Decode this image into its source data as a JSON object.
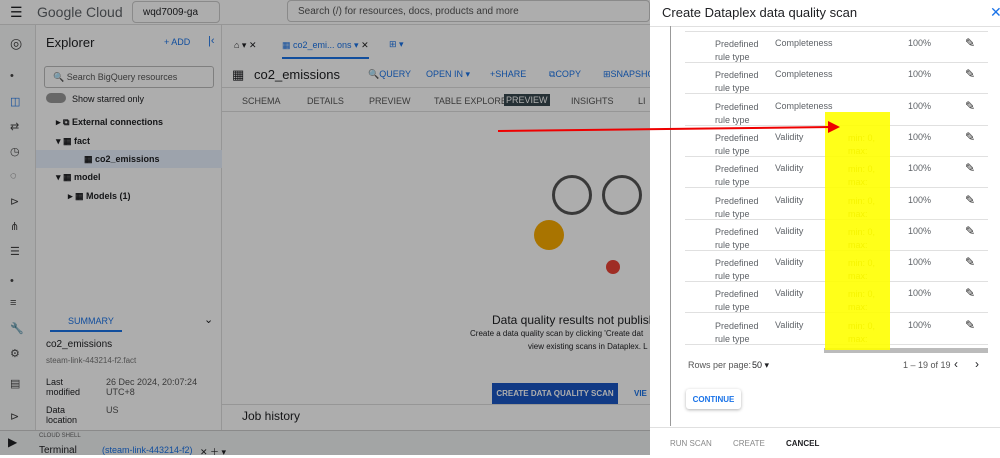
{
  "topbar": {
    "brand": "Google Cloud",
    "project": "wqd7009-ga",
    "search_placeholder": "Search (/) for resources, docs, products and more"
  },
  "explorer": {
    "title": "Explorer",
    "add": "+ ADD",
    "search_placeholder": "Search BigQuery resources",
    "starred": "Show starred only",
    "tree": [
      {
        "label": "External connections"
      },
      {
        "label": "fact"
      },
      {
        "label": "co2_emissions"
      },
      {
        "label": "model"
      },
      {
        "label": "Models (1)"
      }
    ],
    "summary_tab": "SUMMARY",
    "summary_name": "co2_emissions",
    "summary_path": "steam-link-443214-f2.fact",
    "details": [
      {
        "k": "Last modified",
        "v": "26 Dec 2024, 20:07:24 UTC+8"
      },
      {
        "k": "Data location",
        "v": "US"
      }
    ]
  },
  "main": {
    "tab": "co2_emi... ons",
    "table": "co2_emissions",
    "actions": [
      "QUERY",
      "OPEN IN ▾",
      "SHARE",
      "COPY",
      "SNAPSHOT"
    ],
    "subtabs": [
      "SCHEMA",
      "DETAILS",
      "PREVIEW",
      "TABLE EXPLORER",
      "INSIGHTS",
      "LI"
    ],
    "preview_badge": "PREVIEW",
    "empty_title": "Data quality results not publish",
    "empty_line1": "Create a data quality scan by clicking 'Create dat",
    "empty_line2": "view existing scans in Dataplex. L",
    "create_button": "CREATE DATA QUALITY SCAN",
    "view_button": "VIE",
    "job_history": "Job history"
  },
  "shell": {
    "label": "CLOUD SHELL",
    "terminal": "Terminal",
    "session": "(steam-link-443214-f2)"
  },
  "dialog": {
    "title": "Create Dataplex data quality scan",
    "rows": [
      {
        "type": "Predefined rule type",
        "dim": "Completeness",
        "params": "",
        "threshold": "100%"
      },
      {
        "type": "Predefined rule type",
        "dim": "Completeness",
        "params": "",
        "threshold": "100%"
      },
      {
        "type": "Predefined rule type",
        "dim": "Completeness",
        "params": "",
        "threshold": "100%"
      },
      {
        "type": "Predefined rule type",
        "dim": "Validity",
        "params": "min: 0, max:",
        "threshold": "100%"
      },
      {
        "type": "Predefined rule type",
        "dim": "Validity",
        "params": "min: 0, max:",
        "threshold": "100%"
      },
      {
        "type": "Predefined rule type",
        "dim": "Validity",
        "params": "min: 0, max:",
        "threshold": "100%"
      },
      {
        "type": "Predefined rule type",
        "dim": "Validity",
        "params": "min: 0, max:",
        "threshold": "100%"
      },
      {
        "type": "Predefined rule type",
        "dim": "Validity",
        "params": "min: 0, max:",
        "threshold": "100%"
      },
      {
        "type": "Predefined rule type",
        "dim": "Validity",
        "params": "min: 0, max:",
        "threshold": "100%"
      },
      {
        "type": "Predefined rule type",
        "dim": "Validity",
        "params": "min: 0, max:",
        "threshold": "100%"
      }
    ],
    "rows_per_page_label": "Rows per page:",
    "rows_per_page": "50",
    "range": "1 – 19 of 19",
    "continue": "CONTINUE",
    "run_scan": "RUN SCAN",
    "create": "CREATE",
    "cancel": "CANCEL"
  }
}
